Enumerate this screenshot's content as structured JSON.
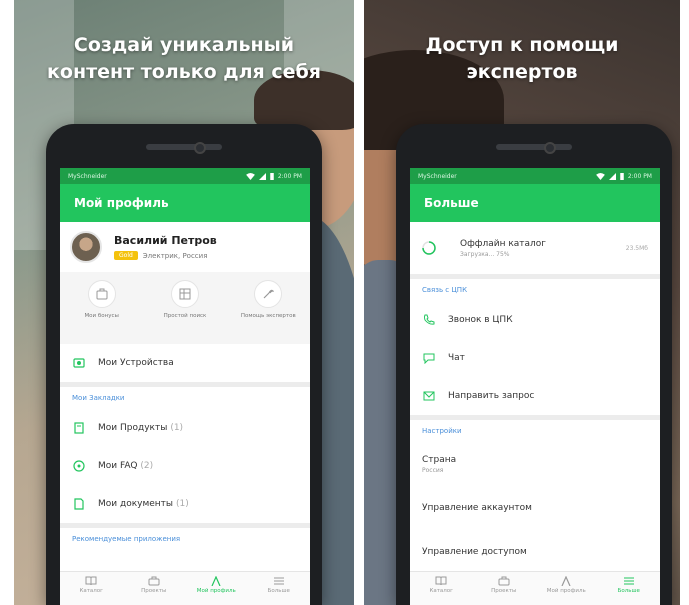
{
  "left": {
    "headline": [
      "Создай уникальный",
      "контент только для себя"
    ],
    "status": {
      "carrier": "MySchneider",
      "time": "2:00 PM"
    },
    "app_title": "Мой профиль",
    "profile": {
      "name": "Василий Петров",
      "badge": "Gold",
      "subtitle": "Электрик, Россия"
    },
    "quick_actions": [
      {
        "icon": "briefcase-icon",
        "label": "Мои бонусы"
      },
      {
        "icon": "catalog-icon",
        "label": "Простой поиск"
      },
      {
        "icon": "wrench-icon",
        "label": "Помощь экспертов"
      }
    ],
    "devices_label": "Мои Устройства",
    "bookmarks_header": "Мои Закладки",
    "bookmarks": [
      {
        "icon": "product-icon",
        "label": "Мои Продукты",
        "count": "(1)"
      },
      {
        "icon": "faq-icon",
        "label": "Мои FAQ",
        "count": "(2)"
      },
      {
        "icon": "document-icon",
        "label": "Мои документы",
        "count": "(1)"
      }
    ],
    "recommended_header": "Рекомендуемые приложения",
    "nav": [
      {
        "icon": "catalog-icon",
        "label": "Каталог"
      },
      {
        "icon": "briefcase-icon",
        "label": "Проекты"
      },
      {
        "icon": "profile-icon",
        "label": "Мой профиль",
        "active": true
      },
      {
        "icon": "menu-icon",
        "label": "Больше"
      }
    ]
  },
  "right": {
    "headline": [
      "Доступ к помощи",
      "экспертов"
    ],
    "status": {
      "carrier": "MySchneider",
      "time": "2:00 PM"
    },
    "app_title": "Больше",
    "offline": {
      "title": "Оффлайн каталог",
      "subtitle": "Загрузка... 75%",
      "size": "23.5Мб"
    },
    "contact_header": "Связь с ЦПК",
    "contact_items": [
      {
        "icon": "phone-icon",
        "label": "Звонок в ЦПК"
      },
      {
        "icon": "chat-icon",
        "label": "Чат"
      },
      {
        "icon": "mail-icon",
        "label": "Направить запрос"
      }
    ],
    "settings_header": "Настройки",
    "country": {
      "title": "Страна",
      "value": "Россия"
    },
    "account_label": "Управление аккаунтом",
    "access_label": "Управление доступом",
    "nav": [
      {
        "icon": "catalog-icon",
        "label": "Каталог"
      },
      {
        "icon": "briefcase-icon",
        "label": "Проекты"
      },
      {
        "icon": "profile-icon",
        "label": "Мой профиль"
      },
      {
        "icon": "menu-icon",
        "label": "Больше",
        "active": true
      }
    ]
  },
  "colors": {
    "accent": "#22c55e",
    "status": "#1e9e48",
    "link": "#4a8fd9",
    "badge": "#f4c20d"
  }
}
